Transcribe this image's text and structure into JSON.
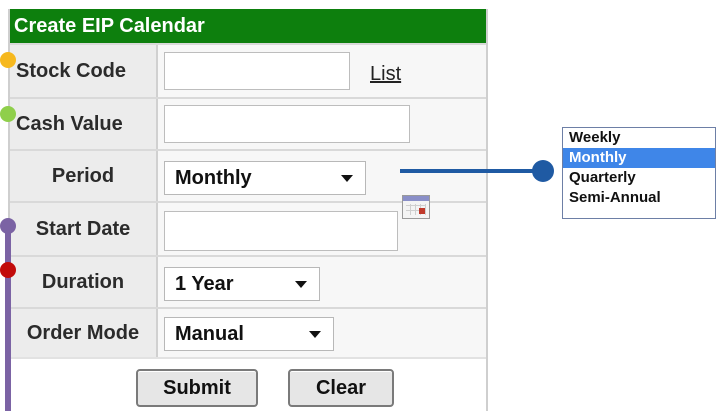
{
  "form": {
    "title": "Create EIP Calendar",
    "stock_code": {
      "label": "Stock Code",
      "value": "",
      "list_link": "List"
    },
    "cash_value": {
      "label": "Cash Value",
      "value": ""
    },
    "period": {
      "label": "Period",
      "selected": "Monthly"
    },
    "start_date": {
      "label": "Start Date",
      "value": ""
    },
    "duration": {
      "label": "Duration",
      "selected": "1 Year"
    },
    "order_mode": {
      "label": "Order Mode",
      "selected": "Manual"
    },
    "submit_label": "Submit",
    "clear_label": "Clear"
  },
  "period_dropdown": {
    "options": [
      "Weekly",
      "Monthly",
      "Quarterly",
      "Semi-Annual"
    ],
    "highlighted": "Monthly"
  },
  "annotation_colors": {
    "stock_code_dot": "#f6b81e",
    "cash_value_dot": "#8fcf4b",
    "start_date_dot": "#7b63a4",
    "duration_dot": "#c20b0b",
    "period_connector": "#1f5aa3"
  }
}
